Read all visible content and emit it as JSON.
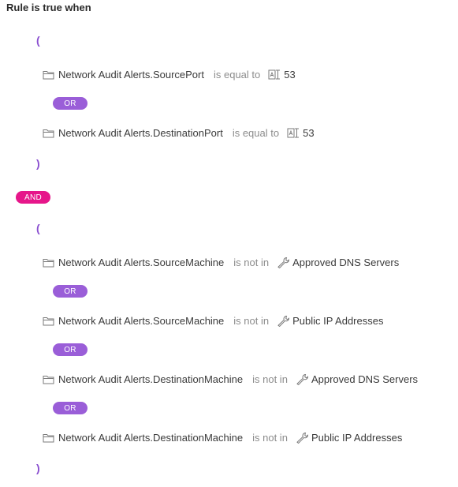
{
  "header": {
    "title": "Rule is true when"
  },
  "groups": [
    {
      "open": "(",
      "close": ")",
      "conditions": [
        {
          "field": "Network Audit Alerts.SourcePort",
          "operator": "is equal to",
          "value_icon": "literal-value-icon",
          "value": "53"
        },
        {
          "field": "Network Audit Alerts.DestinationPort",
          "operator": "is equal to",
          "value_icon": "literal-value-icon",
          "value": "53"
        }
      ],
      "joiner": "OR"
    },
    {
      "open": "(",
      "close": ")",
      "conditions": [
        {
          "field": "Network Audit Alerts.SourceMachine",
          "operator": "is not in",
          "value_icon": "wrench-icon",
          "value": "Approved DNS Servers"
        },
        {
          "field": "Network Audit Alerts.SourceMachine",
          "operator": "is not in",
          "value_icon": "wrench-icon",
          "value": "Public IP Addresses"
        },
        {
          "field": "Network Audit Alerts.DestinationMachine",
          "operator": "is not in",
          "value_icon": "wrench-icon",
          "value": "Approved DNS Servers"
        },
        {
          "field": "Network Audit Alerts.DestinationMachine",
          "operator": "is not in",
          "value_icon": "wrench-icon",
          "value": "Public IP Addresses"
        }
      ],
      "joiner": "OR"
    }
  ],
  "group_joiner": "AND",
  "colors": {
    "or_pill": "#9a5ed8",
    "and_pill": "#e6168a",
    "paren": "#8a4fd0",
    "operator_text": "#8c8c8c"
  }
}
